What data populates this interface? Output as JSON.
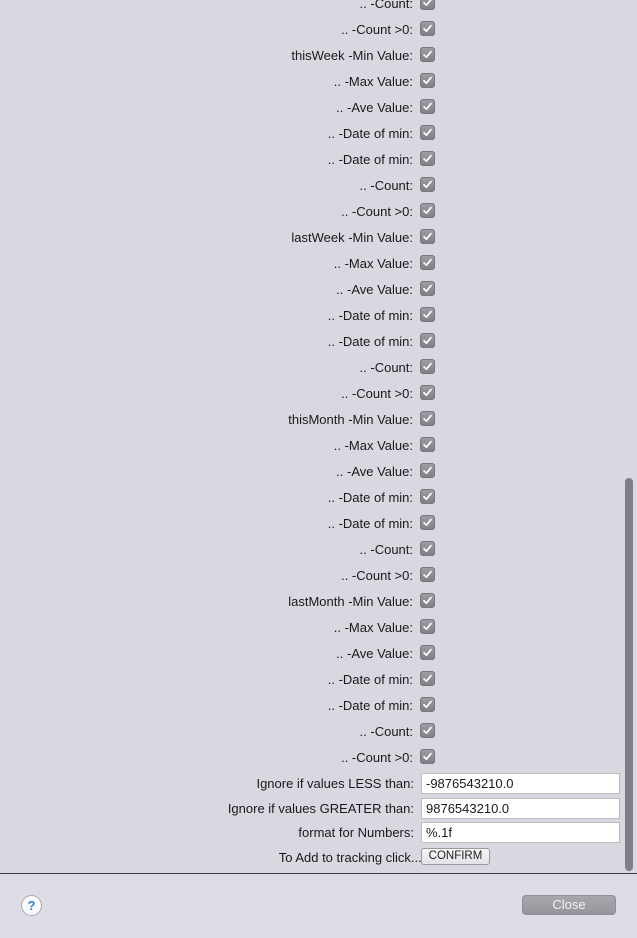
{
  "settings": {
    "rows": [
      {
        "label": ".. -Count:",
        "checked": true
      },
      {
        "label": ".. -Count >0:",
        "checked": true
      },
      {
        "label": "thisWeek -Min Value:",
        "checked": true
      },
      {
        "label": ".. -Max Value:",
        "checked": true
      },
      {
        "label": ".. -Ave Value:",
        "checked": true
      },
      {
        "label": ".. -Date of min:",
        "checked": true
      },
      {
        "label": ".. -Date of min:",
        "checked": true
      },
      {
        "label": ".. -Count:",
        "checked": true
      },
      {
        "label": ".. -Count >0:",
        "checked": true
      },
      {
        "label": "lastWeek -Min Value:",
        "checked": true
      },
      {
        "label": ".. -Max Value:",
        "checked": true
      },
      {
        "label": ".. -Ave Value:",
        "checked": true
      },
      {
        "label": ".. -Date of min:",
        "checked": true
      },
      {
        "label": ".. -Date of min:",
        "checked": true
      },
      {
        "label": ".. -Count:",
        "checked": true
      },
      {
        "label": ".. -Count >0:",
        "checked": true
      },
      {
        "label": "thisMonth -Min Value:",
        "checked": true
      },
      {
        "label": ".. -Max Value:",
        "checked": true
      },
      {
        "label": ".. -Ave Value:",
        "checked": true
      },
      {
        "label": ".. -Date of min:",
        "checked": true
      },
      {
        "label": ".. -Date of min:",
        "checked": true
      },
      {
        "label": ".. -Count:",
        "checked": true
      },
      {
        "label": ".. -Count >0:",
        "checked": true
      },
      {
        "label": "lastMonth -Min Value:",
        "checked": true
      },
      {
        "label": ".. -Max Value:",
        "checked": true
      },
      {
        "label": ".. -Ave Value:",
        "checked": true
      },
      {
        "label": ".. -Date of min:",
        "checked": true
      },
      {
        "label": ".. -Date of min:",
        "checked": true
      },
      {
        "label": ".. -Count:",
        "checked": true
      },
      {
        "label": ".. -Count >0:",
        "checked": true
      }
    ]
  },
  "fields": {
    "less_label": "Ignore if values LESS than:",
    "less_value": "-9876543210.0",
    "greater_label": "Ignore if values GREATER than:",
    "greater_value": "9876543210.0",
    "format_label": "format for Numbers:",
    "format_value": "%.1f",
    "add_label": "To Add  to tracking    click....:",
    "confirm_label": "CONFIRM"
  },
  "footer": {
    "help_label": "?",
    "close_label": "Close"
  },
  "colors": {
    "background": "#d9d8e0",
    "checkbox": "#8e8e94",
    "help_accent": "#3a78d8"
  }
}
